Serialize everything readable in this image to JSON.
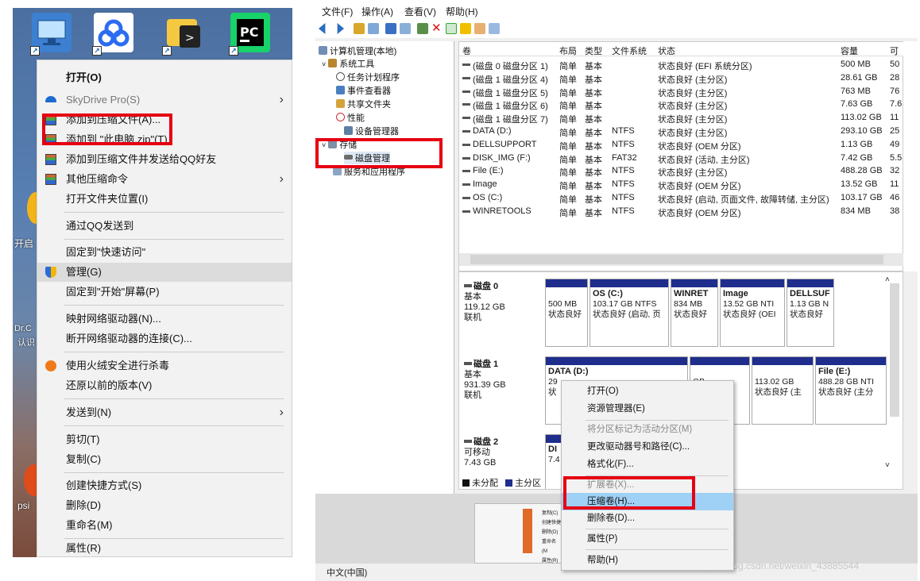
{
  "left": {
    "side_labels": [
      "开启",
      "Dr.C",
      "认识",
      "psi"
    ],
    "context_menu": [
      {
        "label": "打开(O)",
        "bold": true
      },
      {
        "label": "SkyDrive Pro(S)",
        "gray": true,
        "submenu": true
      },
      {
        "label": "添加到压缩文件(A)..."
      },
      {
        "label": "添加到 \"此电脑.zip\"(T)"
      },
      {
        "label": "添加到压缩文件并发送给QQ好友"
      },
      {
        "label": "其他压缩命令",
        "submenu": true
      },
      {
        "label": "打开文件夹位置(I)"
      },
      {
        "label": "通过QQ发送到"
      },
      {
        "label": "固定到\"快速访问\""
      },
      {
        "label": "管理(G)"
      },
      {
        "label": "固定到\"开始\"屏幕(P)"
      },
      {
        "label": "映射网络驱动器(N)..."
      },
      {
        "label": "断开网络驱动器的连接(C)..."
      },
      {
        "label": "使用火绒安全进行杀毒"
      },
      {
        "label": "还原以前的版本(V)"
      },
      {
        "label": "发送到(N)",
        "submenu": true
      },
      {
        "label": "剪切(T)"
      },
      {
        "label": "复制(C)"
      },
      {
        "label": "创建快捷方式(S)"
      },
      {
        "label": "删除(D)"
      },
      {
        "label": "重命名(M)"
      },
      {
        "label": "属性(R)"
      }
    ],
    "icons": {
      "chevron": "›"
    }
  },
  "right": {
    "menu": [
      "文件(F)",
      "操作(A)",
      "查看(V)",
      "帮助(H)"
    ],
    "tree": {
      "root": "计算机管理(本地)",
      "system_tools": "系统工具",
      "task_scheduler": "任务计划程序",
      "event_viewer": "事件查看器",
      "shared_folders": "共享文件夹",
      "performance": "性能",
      "device_manager": "设备管理器",
      "storage": "存储",
      "disk_mgmt": "磁盘管理",
      "services": "服务和应用程序"
    },
    "columns": [
      "卷",
      "布局",
      "类型",
      "文件系统",
      "状态",
      "容量",
      "可"
    ],
    "volumes": [
      {
        "name": "(磁盘 0 磁盘分区 1)",
        "layout": "简单",
        "type": "基本",
        "fs": "",
        "status": "状态良好 (EFI 系统分区)",
        "cap": "500 MB",
        "free": "50"
      },
      {
        "name": "(磁盘 1 磁盘分区 4)",
        "layout": "简单",
        "type": "基本",
        "fs": "",
        "status": "状态良好 (主分区)",
        "cap": "28.61 GB",
        "free": "28"
      },
      {
        "name": "(磁盘 1 磁盘分区 5)",
        "layout": "简单",
        "type": "基本",
        "fs": "",
        "status": "状态良好 (主分区)",
        "cap": "763 MB",
        "free": "76"
      },
      {
        "name": "(磁盘 1 磁盘分区 6)",
        "layout": "简单",
        "type": "基本",
        "fs": "",
        "status": "状态良好 (主分区)",
        "cap": "7.63 GB",
        "free": "7.6"
      },
      {
        "name": "(磁盘 1 磁盘分区 7)",
        "layout": "简单",
        "type": "基本",
        "fs": "",
        "status": "状态良好 (主分区)",
        "cap": "113.02 GB",
        "free": "11"
      },
      {
        "name": "DATA (D:)",
        "layout": "简单",
        "type": "基本",
        "fs": "NTFS",
        "status": "状态良好 (主分区)",
        "cap": "293.10 GB",
        "free": "25"
      },
      {
        "name": "DELLSUPPORT",
        "layout": "简单",
        "type": "基本",
        "fs": "NTFS",
        "status": "状态良好 (OEM 分区)",
        "cap": "1.13 GB",
        "free": "49"
      },
      {
        "name": "DISK_IMG (F:)",
        "layout": "简单",
        "type": "基本",
        "fs": "FAT32",
        "status": "状态良好 (活动, 主分区)",
        "cap": "7.42 GB",
        "free": "5.5"
      },
      {
        "name": "File (E:)",
        "layout": "简单",
        "type": "基本",
        "fs": "NTFS",
        "status": "状态良好 (主分区)",
        "cap": "488.28 GB",
        "free": "32"
      },
      {
        "name": "Image",
        "layout": "简单",
        "type": "基本",
        "fs": "NTFS",
        "status": "状态良好 (OEM 分区)",
        "cap": "13.52 GB",
        "free": "11"
      },
      {
        "name": "OS (C:)",
        "layout": "简单",
        "type": "基本",
        "fs": "NTFS",
        "status": "状态良好 (启动, 页面文件, 故障转储, 主分区)",
        "cap": "103.17 GB",
        "free": "46"
      },
      {
        "name": "WINRETOOLS",
        "layout": "简单",
        "type": "基本",
        "fs": "NTFS",
        "status": "状态良好 (OEM 分区)",
        "cap": "834 MB",
        "free": "38"
      }
    ],
    "disk0": {
      "name": "磁盘 0",
      "type": "基本",
      "size": "119.12 GB",
      "state": "联机"
    },
    "disk1": {
      "name": "磁盘 1",
      "type": "基本",
      "size": "931.39 GB",
      "state": "联机"
    },
    "disk2": {
      "name": "磁盘 2",
      "type": "可移动",
      "size": "7.43 GB"
    },
    "d0parts": [
      {
        "n": "",
        "s": "500 MB",
        "st": "状态良好"
      },
      {
        "n": "OS (C:)",
        "s": "103.17 GB NTFS",
        "st": "状态良好 (启动, 页"
      },
      {
        "n": "WINRET",
        "s": "834 MB",
        "st": "状态良好"
      },
      {
        "n": "Image",
        "s": "13.52 GB NTI",
        "st": "状态良好 (OEI"
      },
      {
        "n": "DELLSUF",
        "s": "1.13 GB N",
        "st": "状态良好"
      }
    ],
    "d1parts": [
      {
        "n": "DATA (D:)",
        "s": "29",
        "st": "状"
      },
      {
        "n": "",
        "s": "GB",
        "st": "好"
      },
      {
        "n": "",
        "s": "113.02 GB",
        "st": "状态良好 (主"
      },
      {
        "n": "File (E:)",
        "s": "488.28 GB NTI",
        "st": "状态良好 (主分"
      }
    ],
    "d2parts": [
      {
        "n": "DI",
        "s": "7.4",
        "st": ""
      }
    ],
    "legend": [
      "未分配",
      "主分区"
    ],
    "submenu": [
      {
        "label": "打开(O)"
      },
      {
        "label": "资源管理器(E)"
      },
      {
        "label": "将分区标记为活动分区(M)",
        "gray": true
      },
      {
        "label": "更改驱动器号和路径(C)..."
      },
      {
        "label": "格式化(F)..."
      },
      {
        "label": "扩展卷(X)...",
        "gray": true
      },
      {
        "label": "压缩卷(H)...",
        "hl": true
      },
      {
        "label": "删除卷(D)..."
      },
      {
        "label": "属性(P)"
      },
      {
        "label": "帮助(H)"
      }
    ],
    "thumb_menu": [
      "复制(C)",
      "创建快捷",
      "删除(D)",
      "重命名(M",
      "属性(R)"
    ],
    "status_text": "中文(中国)",
    "watermark": "https://blog.csdn.net/weixin_43885544"
  },
  "colors": {
    "highlight_red": "#e60012",
    "partition_bar": "#1f2d8c",
    "selected_blue": "#9fd0f5"
  }
}
